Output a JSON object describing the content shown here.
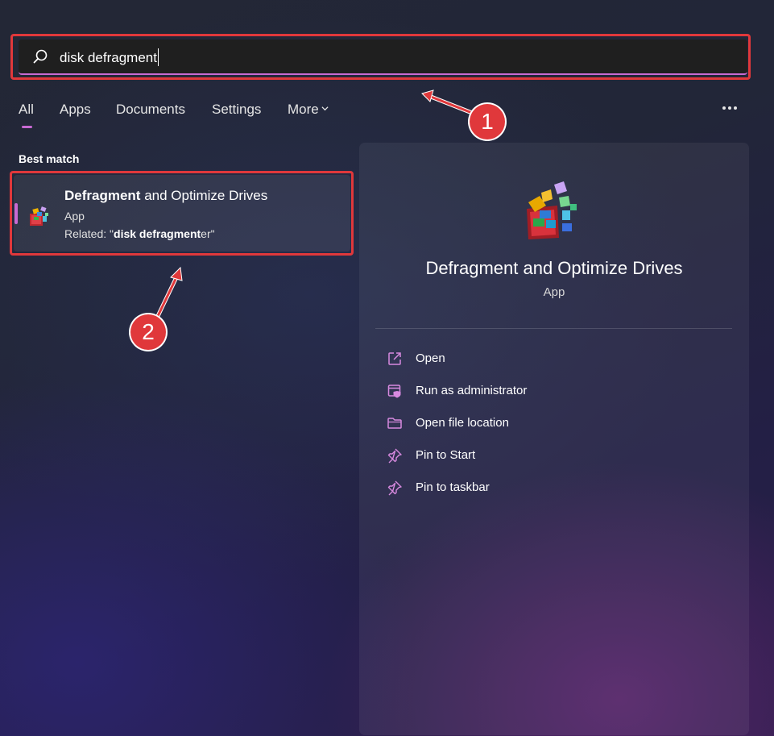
{
  "search": {
    "query": "disk defragment"
  },
  "tabs": [
    {
      "label": "All"
    },
    {
      "label": "Apps"
    },
    {
      "label": "Documents"
    },
    {
      "label": "Settings"
    },
    {
      "label": "More"
    }
  ],
  "more_options_icon": "ellipsis-icon",
  "best_match": {
    "section_label": "Best match",
    "title_bold": "Defragment",
    "title_rest": " and Optimize Drives",
    "type": "App",
    "related_prefix": "Related: \"",
    "related_bold": "disk defragment",
    "related_suffix": "er\""
  },
  "detail": {
    "title": "Defragment and Optimize Drives",
    "type": "App",
    "actions": [
      {
        "label": "Open",
        "icon": "open-external-icon"
      },
      {
        "label": "Run as administrator",
        "icon": "shield-window-icon"
      },
      {
        "label": "Open file location",
        "icon": "folder-icon"
      },
      {
        "label": "Pin to Start",
        "icon": "pin-icon"
      },
      {
        "label": "Pin to taskbar",
        "icon": "pin-icon"
      }
    ]
  },
  "annotations": [
    {
      "number": "1"
    },
    {
      "number": "2"
    }
  ],
  "colors": {
    "accent": "#c86ad3",
    "highlight_red": "#e0383b",
    "search_bg": "#1f1f1f"
  }
}
